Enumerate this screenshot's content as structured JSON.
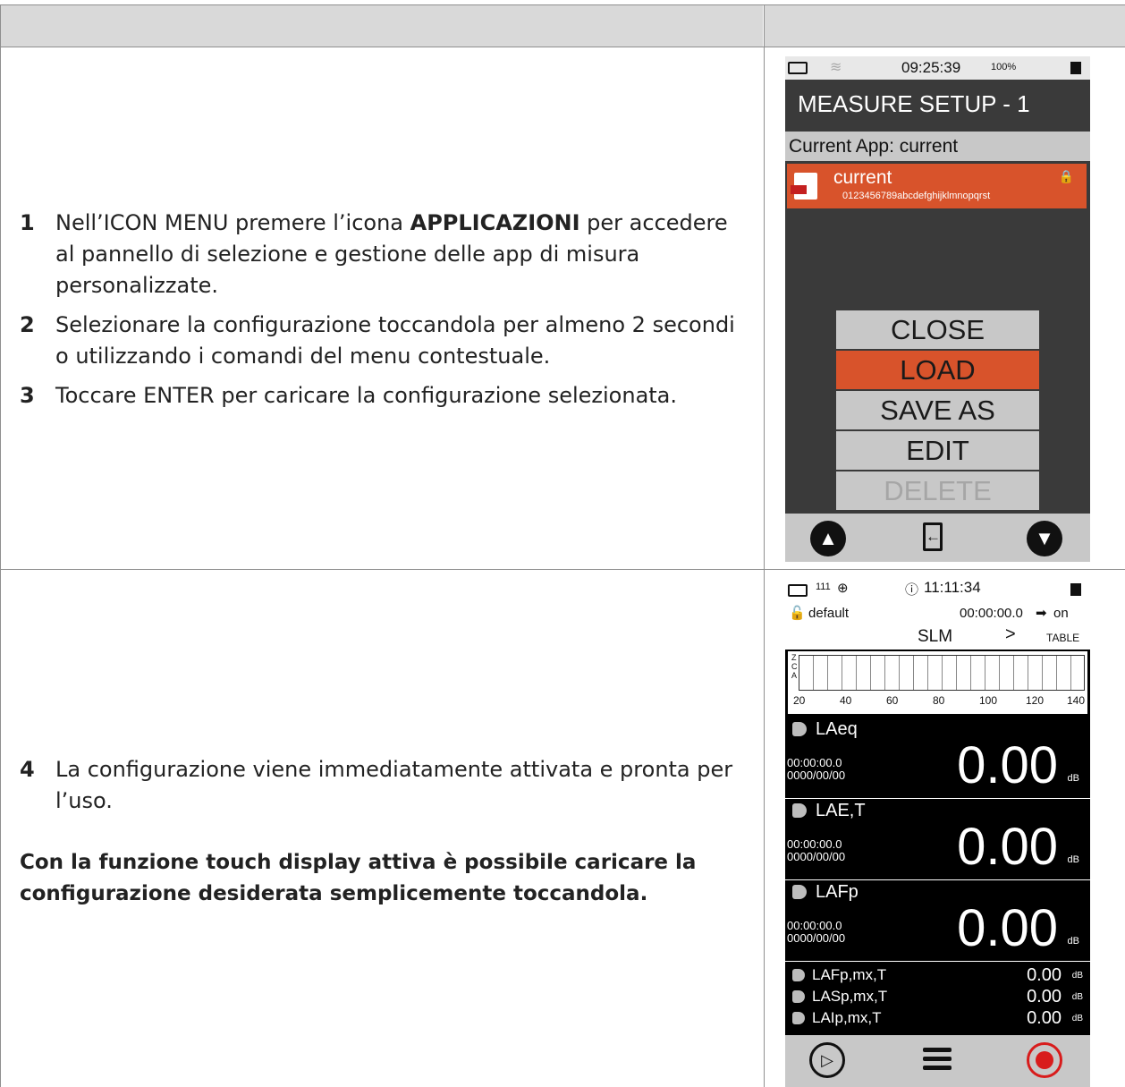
{
  "section1": {
    "steps": [
      {
        "num": "1",
        "pre": "Nell’ICON MENU premere l’icona ",
        "bold": "APPLICAZIONI",
        "post": " per accedere al pannello di selezione e gestione delle app di misura personalizzate."
      },
      {
        "num": "2",
        "text": "Selezionare la configurazione toccandola per almeno 2 secondi o utilizzando i comandi del menu contestuale."
      },
      {
        "num": "3",
        "text": "Toccare ENTER per caricare la configurazione selezionata."
      }
    ]
  },
  "section2": {
    "steps": [
      {
        "num": "4",
        "text": "La configurazione viene immediatamente attivata e pronta per l’uso."
      }
    ],
    "note": "Con la funzione touch display attiva è possibile caricare la configurazione desiderata semplicemente toccandola."
  },
  "screen1": {
    "status": {
      "time": "09:25:39",
      "battery": "100%"
    },
    "title": "MEASURE SETUP - 1",
    "current_app_label": "Current App: current",
    "row": {
      "name": "current",
      "sub": "0123456789abcdefghijklmnopqrst"
    },
    "menu": [
      {
        "label": "CLOSE",
        "state": "normal"
      },
      {
        "label": "LOAD",
        "state": "selected"
      },
      {
        "label": "SAVE AS",
        "state": "normal"
      },
      {
        "label": "EDIT",
        "state": "normal"
      },
      {
        "label": "DELETE",
        "state": "disabled"
      }
    ]
  },
  "screen2": {
    "status": {
      "counter": "111",
      "time": "11:11:34"
    },
    "profile": "default",
    "timer": "00:00:00.0",
    "on_label": "on",
    "mode": "SLM",
    "next_label": "TABLE",
    "scale_letters": [
      "Z",
      "C",
      "A"
    ],
    "scale_ticks": [
      "20",
      "40",
      "60",
      "80",
      "100",
      "120",
      "140"
    ],
    "measures": [
      {
        "label": "LAeq",
        "time": "00:00:00.0",
        "date": "0000/00/00",
        "value": "0.00",
        "unit": "dB"
      },
      {
        "label": "LAE,T",
        "time": "00:00:00.0",
        "date": "0000/00/00",
        "value": "0.00",
        "unit": "dB"
      },
      {
        "label": "LAFp",
        "time": "00:00:00.0",
        "date": "0000/00/00",
        "value": "0.00",
        "unit": "dB"
      }
    ],
    "small_measures": [
      {
        "label": "LAFp,mx,T",
        "value": "0.00",
        "unit": "dB"
      },
      {
        "label": "LASp,mx,T",
        "value": "0.00",
        "unit": "dB"
      },
      {
        "label": "LAIp,mx,T",
        "value": "0.00",
        "unit": "dB"
      }
    ]
  },
  "colors": {
    "accent": "#d8532b",
    "header": "#d9d9d9",
    "record": "#d81c1c"
  }
}
